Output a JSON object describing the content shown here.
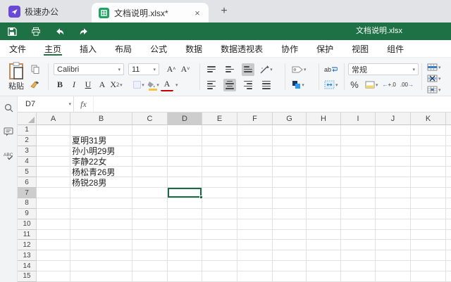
{
  "window": {
    "app_name": "极速办公",
    "tab_title": "文档说明.xlsx*",
    "close_glyph": "×",
    "new_tab_glyph": "+",
    "toolbar_document_title": "文档说明.xlsx"
  },
  "toolbar_icons": [
    "save-icon",
    "print-icon",
    "undo-icon",
    "redo-icon"
  ],
  "menu": {
    "items": [
      {
        "label": "文件",
        "active": false
      },
      {
        "label": "主页",
        "active": true
      },
      {
        "label": "插入",
        "active": false
      },
      {
        "label": "布局",
        "active": false
      },
      {
        "label": "公式",
        "active": false
      },
      {
        "label": "数据",
        "active": false
      },
      {
        "label": "数据透视表",
        "active": false
      },
      {
        "label": "协作",
        "active": false
      },
      {
        "label": "保护",
        "active": false
      },
      {
        "label": "视图",
        "active": false
      },
      {
        "label": "组件",
        "active": false
      }
    ]
  },
  "ribbon": {
    "paste_label": "粘贴",
    "font_name": "Calibri",
    "font_size": "11",
    "grow_font": "A",
    "shrink_font": "A",
    "bold": "B",
    "italic": "I",
    "underline": "U",
    "char_style": "A",
    "subscript_base": "X",
    "subscript_sub": "2",
    "font_color": "A",
    "wrap_text": "ab",
    "number_format": "常规",
    "percent": "%",
    "increase_decimal": "+.0",
    "decrease_decimal": ".00"
  },
  "formula_bar": {
    "cell_reference": "D7",
    "fx_label": "fx",
    "value": ""
  },
  "sidebar_icons": [
    "search-icon",
    "comment-icon",
    "spellcheck-icon"
  ],
  "grid": {
    "columns": [
      "A",
      "B",
      "C",
      "D",
      "E",
      "F",
      "G",
      "H",
      "I",
      "J",
      "K"
    ],
    "row_count": 15,
    "selected_cell": {
      "column": "D",
      "row": 7
    },
    "cells": [
      {
        "row": 2,
        "column": "B",
        "value": "夏明31男"
      },
      {
        "row": 3,
        "column": "B",
        "value": "孙小明29男"
      },
      {
        "row": 4,
        "column": "B",
        "value": "李静22女"
      },
      {
        "row": 5,
        "column": "B",
        "value": "杨松青26男"
      },
      {
        "row": 6,
        "column": "B",
        "value": "杨锐28男"
      }
    ]
  },
  "colors": {
    "brand_green": "#1e7145",
    "tab_icon_green": "#21a366",
    "app_icon_purple": "#6b47d6",
    "selection_green": "#1a6b43",
    "font_color_red": "#c00000",
    "fill_yellow": "#f6c344",
    "accent_blue": "#2b7cd3"
  }
}
